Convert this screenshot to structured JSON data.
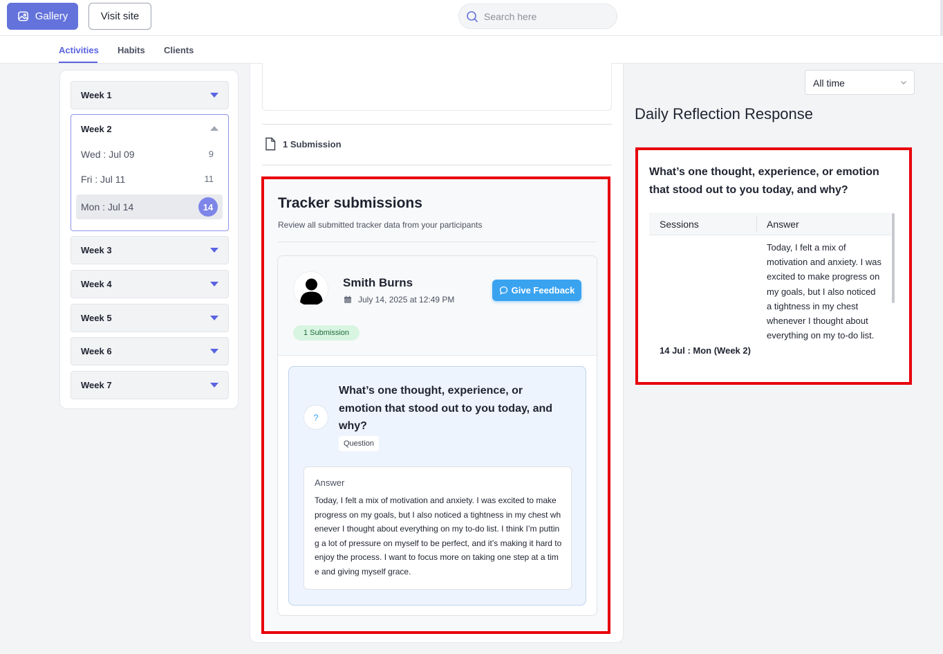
{
  "topbar": {
    "gallery_label": "Gallery",
    "visit_label": "Visit site",
    "search_placeholder": "Search here"
  },
  "tabs": [
    {
      "label": "Activities",
      "active": true
    },
    {
      "label": "Habits",
      "active": false
    },
    {
      "label": "Clients",
      "active": false
    }
  ],
  "sidebar": {
    "weeks": [
      {
        "label": "Week 1",
        "expanded": false
      },
      {
        "label": "Week 2",
        "expanded": true,
        "days": [
          {
            "label": "Wed : Jul 09",
            "count": "9"
          },
          {
            "label": "Fri : Jul 11",
            "count": "11"
          },
          {
            "label": "Mon : Jul 14",
            "count": "14",
            "selected": true
          }
        ]
      },
      {
        "label": "Week 3",
        "expanded": false
      },
      {
        "label": "Week 4",
        "expanded": false
      },
      {
        "label": "Week 5",
        "expanded": false
      },
      {
        "label": "Week 6",
        "expanded": false
      },
      {
        "label": "Week 7",
        "expanded": false
      }
    ]
  },
  "main": {
    "submission_count": "1 Submission",
    "tracker": {
      "title": "Tracker submissions",
      "subtitle": "Review all submitted tracker data from your participants",
      "participant": {
        "name": "Smith Burns",
        "date": "July 14, 2025 at 12:49 PM",
        "feedback_label": "Give Feedback",
        "badge": "1 Submission"
      },
      "question": {
        "text": "What’s one thought, experience, or emotion that stood out to you today, and why?",
        "tag": "Question",
        "icon": "?"
      },
      "answer": {
        "label": "Answer",
        "text": "Today, I felt a mix of motivation and anxiety. I was excited to make progress on my goals, but I also noticed a tightness in my chest whenever I thought about everything on my to-do list. I think I’m putting a lot of pressure on myself to be perfect, and it’s making it hard to enjoy the process. I want to focus more on taking one step at a time and giving myself grace."
      }
    }
  },
  "right": {
    "filter_value": "All time",
    "title": "Daily Reflection Response",
    "question": "What’s one thought, experience, or emotion that stood out to you today, and why?",
    "table": {
      "headers": [
        "Sessions",
        "Answer"
      ],
      "rows": [
        {
          "session": "14 Jul : Mon (Week 2)",
          "answer": "Today, I felt a mix of motivation and anxiety. I was excited to make progress on my goals, but I also noticed a tightness in my chest whenever I thought about everything on my to-do list."
        }
      ]
    }
  },
  "colors": {
    "accent": "#5a63e0",
    "gallery_button": "#6473db",
    "feedback_button": "#3aa3f0",
    "highlight_border": "#e8000b"
  }
}
